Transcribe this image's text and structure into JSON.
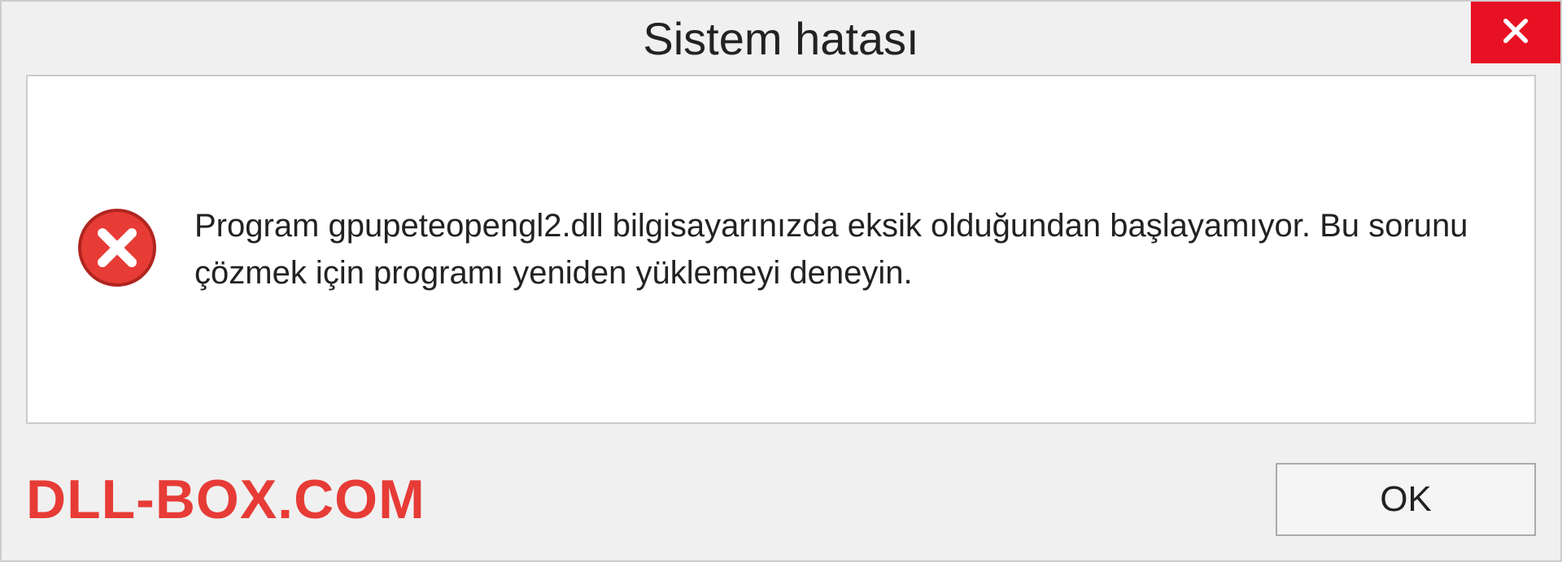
{
  "dialog": {
    "title": "Sistem hatası",
    "message": "Program gpupeteopengl2.dll bilgisayarınızda eksik olduğundan başlayamıyor. Bu sorunu çözmek için programı yeniden yüklemeyi deneyin.",
    "ok_label": "OK"
  },
  "watermark": "DLL-BOX.COM",
  "colors": {
    "close_button": "#e81123",
    "error_icon": "#e73b36",
    "watermark": "#e73b36"
  }
}
